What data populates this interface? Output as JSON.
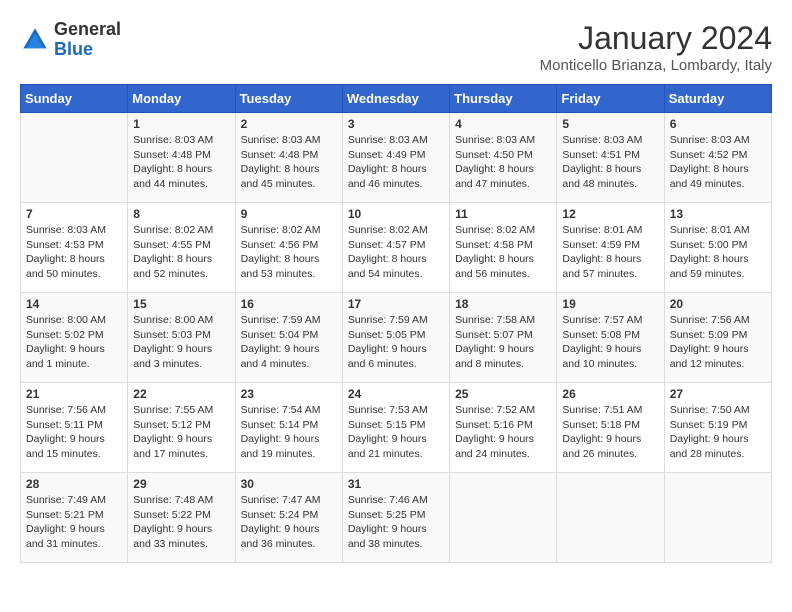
{
  "header": {
    "logo_general": "General",
    "logo_blue": "Blue",
    "title": "January 2024",
    "subtitle": "Monticello Brianza, Lombardy, Italy"
  },
  "days_of_week": [
    "Sunday",
    "Monday",
    "Tuesday",
    "Wednesday",
    "Thursday",
    "Friday",
    "Saturday"
  ],
  "weeks": [
    [
      {
        "day": "",
        "info": ""
      },
      {
        "day": "1",
        "info": "Sunrise: 8:03 AM\nSunset: 4:48 PM\nDaylight: 8 hours\nand 44 minutes."
      },
      {
        "day": "2",
        "info": "Sunrise: 8:03 AM\nSunset: 4:48 PM\nDaylight: 8 hours\nand 45 minutes."
      },
      {
        "day": "3",
        "info": "Sunrise: 8:03 AM\nSunset: 4:49 PM\nDaylight: 8 hours\nand 46 minutes."
      },
      {
        "day": "4",
        "info": "Sunrise: 8:03 AM\nSunset: 4:50 PM\nDaylight: 8 hours\nand 47 minutes."
      },
      {
        "day": "5",
        "info": "Sunrise: 8:03 AM\nSunset: 4:51 PM\nDaylight: 8 hours\nand 48 minutes."
      },
      {
        "day": "6",
        "info": "Sunrise: 8:03 AM\nSunset: 4:52 PM\nDaylight: 8 hours\nand 49 minutes."
      }
    ],
    [
      {
        "day": "7",
        "info": "Sunrise: 8:03 AM\nSunset: 4:53 PM\nDaylight: 8 hours\nand 50 minutes."
      },
      {
        "day": "8",
        "info": "Sunrise: 8:02 AM\nSunset: 4:55 PM\nDaylight: 8 hours\nand 52 minutes."
      },
      {
        "day": "9",
        "info": "Sunrise: 8:02 AM\nSunset: 4:56 PM\nDaylight: 8 hours\nand 53 minutes."
      },
      {
        "day": "10",
        "info": "Sunrise: 8:02 AM\nSunset: 4:57 PM\nDaylight: 8 hours\nand 54 minutes."
      },
      {
        "day": "11",
        "info": "Sunrise: 8:02 AM\nSunset: 4:58 PM\nDaylight: 8 hours\nand 56 minutes."
      },
      {
        "day": "12",
        "info": "Sunrise: 8:01 AM\nSunset: 4:59 PM\nDaylight: 8 hours\nand 57 minutes."
      },
      {
        "day": "13",
        "info": "Sunrise: 8:01 AM\nSunset: 5:00 PM\nDaylight: 8 hours\nand 59 minutes."
      }
    ],
    [
      {
        "day": "14",
        "info": "Sunrise: 8:00 AM\nSunset: 5:02 PM\nDaylight: 9 hours\nand 1 minute."
      },
      {
        "day": "15",
        "info": "Sunrise: 8:00 AM\nSunset: 5:03 PM\nDaylight: 9 hours\nand 3 minutes."
      },
      {
        "day": "16",
        "info": "Sunrise: 7:59 AM\nSunset: 5:04 PM\nDaylight: 9 hours\nand 4 minutes."
      },
      {
        "day": "17",
        "info": "Sunrise: 7:59 AM\nSunset: 5:05 PM\nDaylight: 9 hours\nand 6 minutes."
      },
      {
        "day": "18",
        "info": "Sunrise: 7:58 AM\nSunset: 5:07 PM\nDaylight: 9 hours\nand 8 minutes."
      },
      {
        "day": "19",
        "info": "Sunrise: 7:57 AM\nSunset: 5:08 PM\nDaylight: 9 hours\nand 10 minutes."
      },
      {
        "day": "20",
        "info": "Sunrise: 7:56 AM\nSunset: 5:09 PM\nDaylight: 9 hours\nand 12 minutes."
      }
    ],
    [
      {
        "day": "21",
        "info": "Sunrise: 7:56 AM\nSunset: 5:11 PM\nDaylight: 9 hours\nand 15 minutes."
      },
      {
        "day": "22",
        "info": "Sunrise: 7:55 AM\nSunset: 5:12 PM\nDaylight: 9 hours\nand 17 minutes."
      },
      {
        "day": "23",
        "info": "Sunrise: 7:54 AM\nSunset: 5:14 PM\nDaylight: 9 hours\nand 19 minutes."
      },
      {
        "day": "24",
        "info": "Sunrise: 7:53 AM\nSunset: 5:15 PM\nDaylight: 9 hours\nand 21 minutes."
      },
      {
        "day": "25",
        "info": "Sunrise: 7:52 AM\nSunset: 5:16 PM\nDaylight: 9 hours\nand 24 minutes."
      },
      {
        "day": "26",
        "info": "Sunrise: 7:51 AM\nSunset: 5:18 PM\nDaylight: 9 hours\nand 26 minutes."
      },
      {
        "day": "27",
        "info": "Sunrise: 7:50 AM\nSunset: 5:19 PM\nDaylight: 9 hours\nand 28 minutes."
      }
    ],
    [
      {
        "day": "28",
        "info": "Sunrise: 7:49 AM\nSunset: 5:21 PM\nDaylight: 9 hours\nand 31 minutes."
      },
      {
        "day": "29",
        "info": "Sunrise: 7:48 AM\nSunset: 5:22 PM\nDaylight: 9 hours\nand 33 minutes."
      },
      {
        "day": "30",
        "info": "Sunrise: 7:47 AM\nSunset: 5:24 PM\nDaylight: 9 hours\nand 36 minutes."
      },
      {
        "day": "31",
        "info": "Sunrise: 7:46 AM\nSunset: 5:25 PM\nDaylight: 9 hours\nand 38 minutes."
      },
      {
        "day": "",
        "info": ""
      },
      {
        "day": "",
        "info": ""
      },
      {
        "day": "",
        "info": ""
      }
    ]
  ]
}
